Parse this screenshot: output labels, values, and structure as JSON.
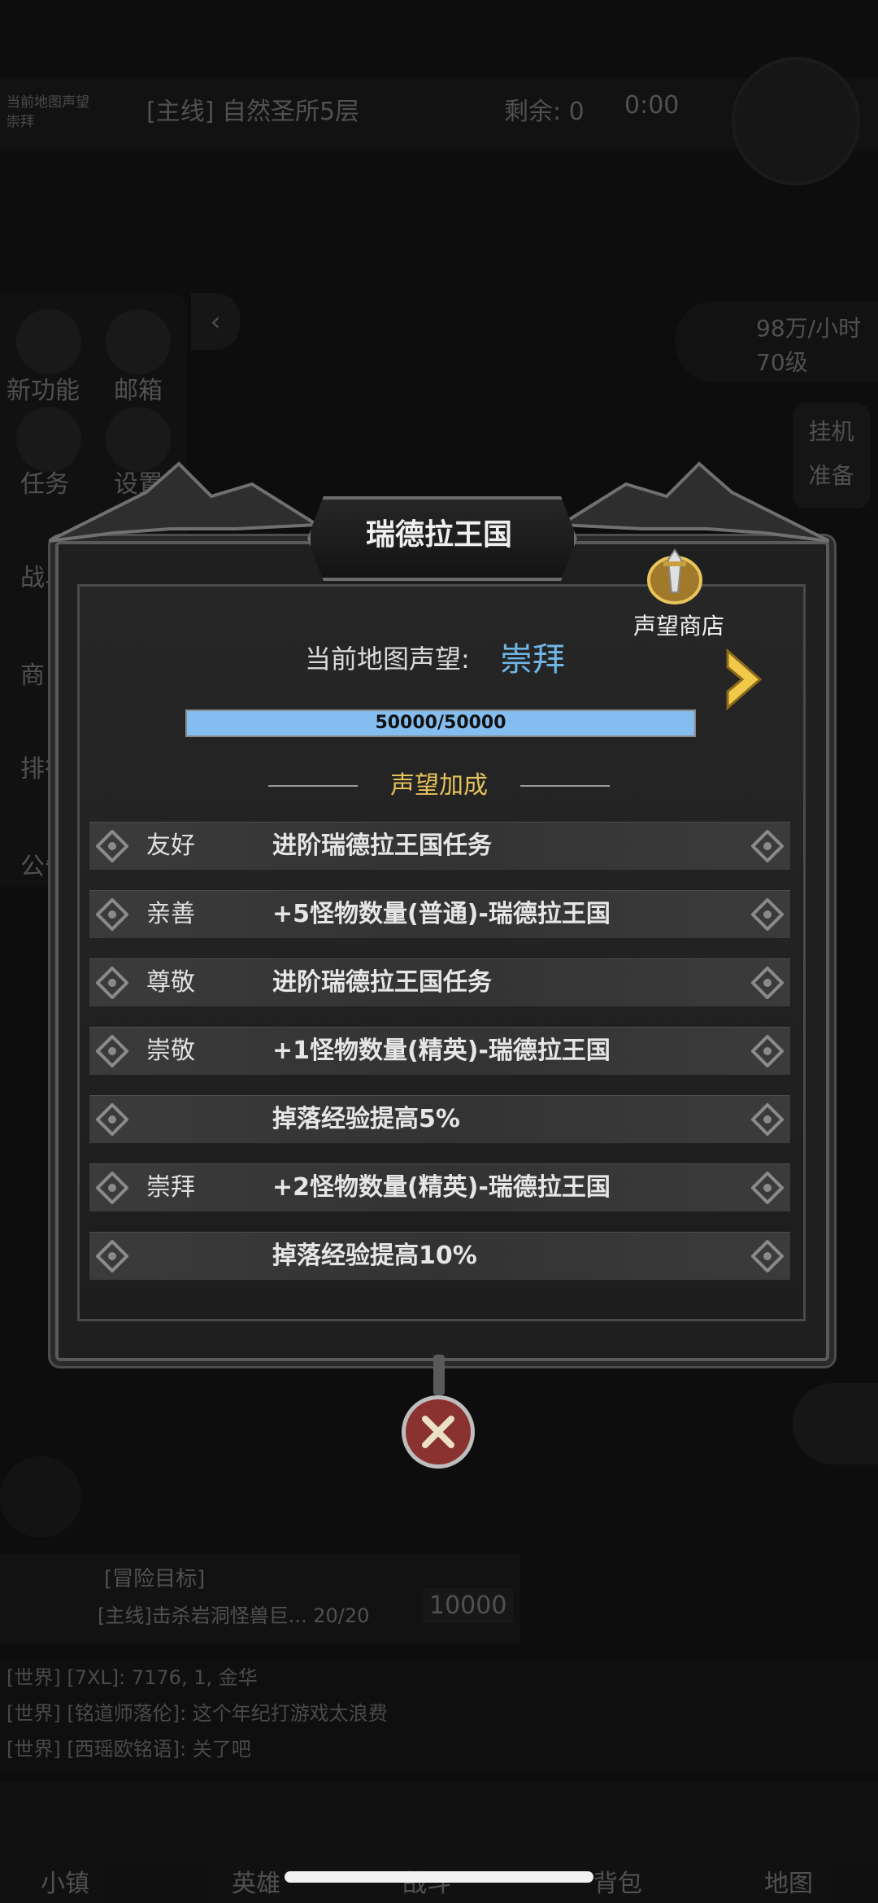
{
  "background": {
    "topbar": {
      "left_text_line1": "当前地图声望",
      "left_text_line2": "崇拜",
      "quest": "[主线] 自然圣所5层",
      "remaining": "剩余: 0",
      "timer": "0:00"
    },
    "side_menu": [
      "新功能",
      "邮箱",
      "任务",
      "设置",
      "战斗",
      "商",
      "排行",
      "公告"
    ],
    "rate": {
      "per_hour": "98万/小时",
      "level": "70级"
    },
    "idle_button": [
      "挂机",
      "准备"
    ],
    "goal": {
      "title": "[冒险目标]",
      "text": "[主线]击杀岩洞怪兽巨...",
      "progress": "20/20",
      "reward": "10000"
    },
    "chat": [
      "[世界] [7XL]: 7176, 1, 金华",
      "[世界] [铭道师落伦]: 这个年纪打游戏太浪费",
      "[世界] [西瑶欧铭语]: 关了吧"
    ],
    "bottom_nav": [
      "小镇",
      "英雄",
      "战斗",
      "背包",
      "地图"
    ]
  },
  "modal": {
    "title": "瑞德拉王国",
    "shop_label": "声望商店",
    "current_label": "当前地图声望:",
    "current_value": "崇拜",
    "progress": {
      "text": "50000/50000",
      "fraction": 1.0
    },
    "bonus_header": "声望加成",
    "rows": [
      {
        "rank": "友好",
        "desc": "进阶瑞德拉王国任务"
      },
      {
        "rank": "亲善",
        "desc": "+5怪物数量(普通)-瑞德拉王国"
      },
      {
        "rank": "尊敬",
        "desc": "进阶瑞德拉王国任务"
      },
      {
        "rank": "崇敬",
        "desc": "+1怪物数量(精英)-瑞德拉王国"
      },
      {
        "rank": "",
        "desc": "掉落经验提高5%"
      },
      {
        "rank": "崇拜",
        "desc": "+2怪物数量(精英)-瑞德拉王国"
      },
      {
        "rank": "",
        "desc": "掉落经验提高10%"
      }
    ]
  },
  "colors": {
    "accent_gold": "#e6c25a",
    "value_blue": "#6fb6e6",
    "progress_fill": "#84bef0",
    "close_red": "#8a3230"
  },
  "icons": [
    "shop-icon",
    "chevron-right-icon",
    "close-icon",
    "ornament-icon"
  ]
}
